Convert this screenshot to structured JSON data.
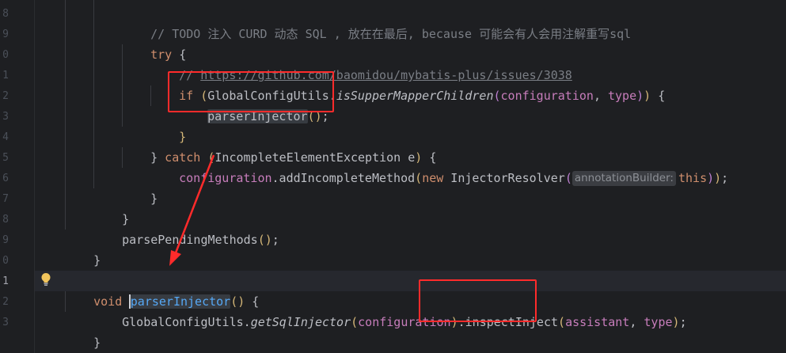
{
  "editor": {
    "line_numbers": [
      "8",
      "9",
      "0",
      "1",
      "2",
      "3",
      "4",
      "5",
      "6",
      "7",
      "8",
      "9",
      "0",
      "1",
      "2",
      "3"
    ],
    "current_line_number": "1",
    "code": {
      "l1_comment": "// TODO 注入 CURD 动态 SQL , 放在在最后, because 可能会有人会用注解重写sql",
      "l2_try": "try",
      "l2_brace": " {",
      "l3_comment_prefix": "// ",
      "l3_url": "https://github.com/baomidou/mybatis-plus/issues/3038",
      "l4_if": "if",
      "l4_paren_open": " (",
      "l4_class": "GlobalConfigUtils.",
      "l4_method": "isSupperMapperChildren",
      "l4_arg_open": "(",
      "l4_arg1": "configuration",
      "l4_sep": ", ",
      "l4_arg2": "type",
      "l4_arg_close": ")",
      "l4_close": ")",
      "l4_brace": " {",
      "l5_call": "parserInjector",
      "l5_parens": "()",
      "l5_semi": ";",
      "l6_brace": "}",
      "l7_close": "}",
      "l7_catch": " catch",
      "l7_paren_open": " (",
      "l7_exception": "IncompleteElementException e",
      "l7_paren_close": ")",
      "l7_brace": " {",
      "l8_field": "configuration",
      "l8_method": ".addIncompleteMethod",
      "l8_paren_open": "(",
      "l8_new": "new",
      "l8_class": " InjectorResolver",
      "l8_inner_open": "(",
      "l8_hint": "annotationBuilder:",
      "l8_this": "this",
      "l8_inner_close": ")",
      "l8_outer_close": ")",
      "l8_semi": ";",
      "l9_brace": "}",
      "l10_brace": "}",
      "l11_call": "parsePendingMethods",
      "l11_parens": "()",
      "l11_semi": ";",
      "l12_brace": "}",
      "l14_void": "void",
      "l14_method": "parserInjector",
      "l14_parens": "()",
      "l14_brace": " {",
      "l15_class": "GlobalConfigUtils.",
      "l15_method": "getSqlInjector",
      "l15_paren_open": "(",
      "l15_field": "configuration",
      "l15_paren_close": ")",
      "l15_call": ".inspectInject",
      "l15_args_open": "(",
      "l15_arg1": "assistant",
      "l15_sep": ", ",
      "l15_arg2": "type",
      "l15_args_close": ")",
      "l15_semi": ";",
      "l16_brace": "}"
    }
  },
  "colors": {
    "background": "#1e1f22",
    "keyword": "#cf8e6d",
    "comment": "#7a7e85",
    "field": "#c77dbb",
    "method_declaration": "#56a8f5",
    "annotation_red": "#ff2b2b"
  },
  "icons": {
    "intention": "lightbulb-icon",
    "annotation_arrow": "red-arrow"
  }
}
